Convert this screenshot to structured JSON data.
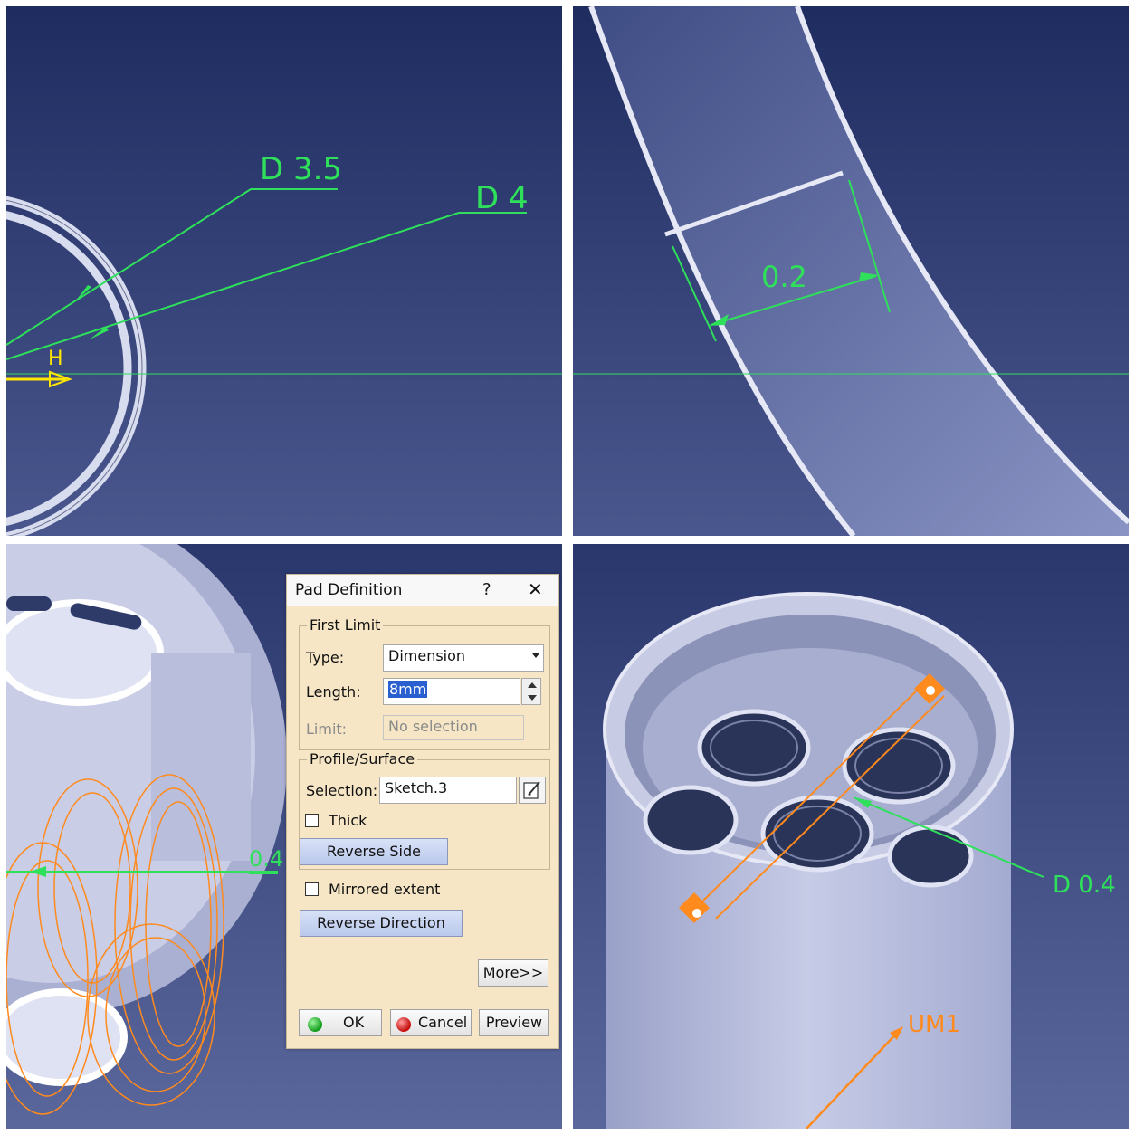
{
  "panel1": {
    "dim_outer": "D 3.5",
    "dim_inner": "D 4",
    "axis_label": "H"
  },
  "panel2": {
    "dim_label": "0.2"
  },
  "panel3": {
    "dim_label": "0.4",
    "dialog": {
      "title": "Pad Definition",
      "help_glyph": "?",
      "close_glyph": "✕",
      "first_limit": {
        "heading": "First Limit",
        "type_label": "Type:",
        "type_value": "Dimension",
        "length_label": "Length:",
        "length_value": "8mm",
        "limit_label": "Limit:",
        "limit_value": "No selection"
      },
      "profile": {
        "heading": "Profile/Surface",
        "selection_label": "Selection:",
        "selection_value": "Sketch.3",
        "thick_label": "Thick",
        "reverse_side_label": "Reverse Side"
      },
      "mirrored_label": "Mirrored extent",
      "reverse_direction_label": "Reverse Direction",
      "more_label": "More>>",
      "ok_label": "OK",
      "cancel_label": "Cancel",
      "preview_label": "Preview"
    }
  },
  "panel4": {
    "dim_label": "D 0.4",
    "feature_label": "UM1"
  },
  "colors": {
    "bg_dark": "#1e2a5e",
    "bg_light": "#5f6ea3",
    "dim_green": "#2ee05a",
    "axis_yellow": "#ffe600",
    "sketch_orange": "#ff8a1e",
    "part_face": "#c8cce3",
    "dialog_bg": "#f6e6c6"
  },
  "icons": [
    "edit-sketch-icon",
    "ok-status-icon",
    "cancel-status-icon",
    "help-icon",
    "close-icon",
    "spinner-up-icon",
    "spinner-down-icon",
    "dropdown-arrow-icon"
  ]
}
